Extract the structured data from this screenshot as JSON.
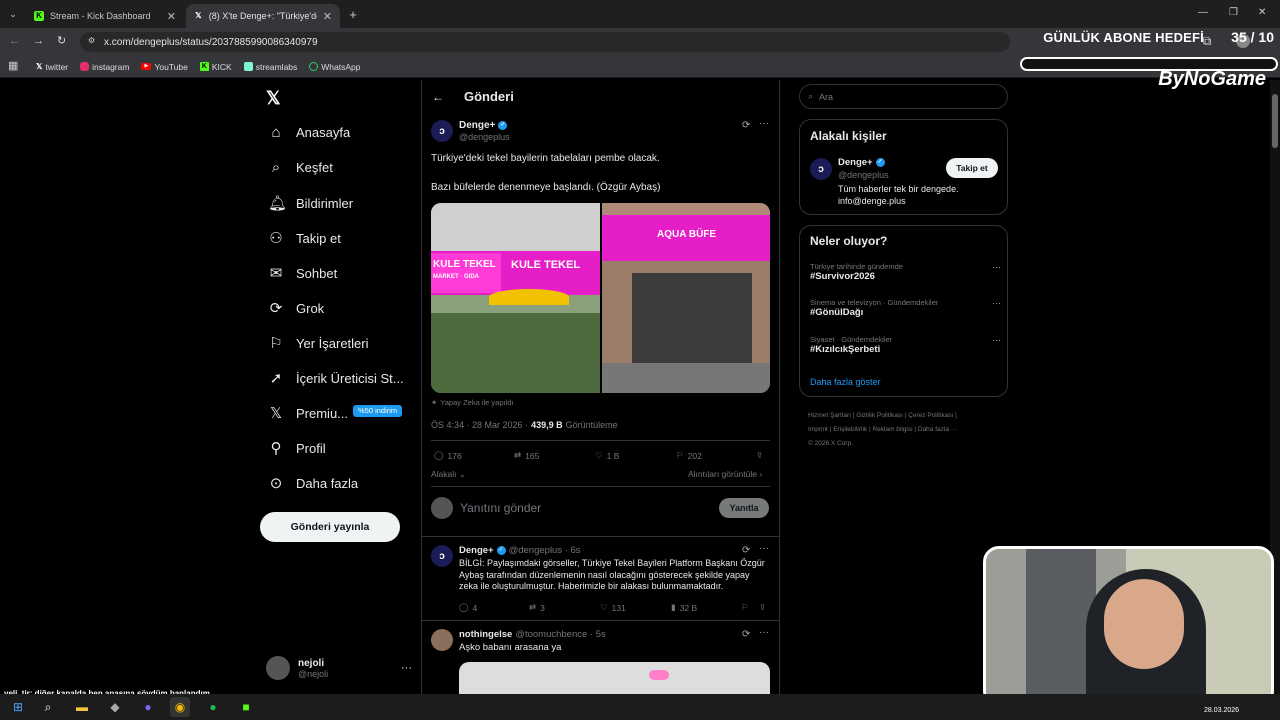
{
  "browser": {
    "tabs": [
      {
        "title": "Stream - Kick Dashboard",
        "icon": "kick-icon"
      },
      {
        "title": "(8) X'te Denge+: \"Türkiye'deki t",
        "icon": "x-icon"
      }
    ],
    "url": "x.com/dengeplus/status/2037885990086340979",
    "bookmarks": [
      {
        "label": "twitter",
        "icon": "x-icon"
      },
      {
        "label": "instagram",
        "icon": "instagram-icon"
      },
      {
        "label": "YouTube",
        "icon": "youtube-icon"
      },
      {
        "label": "KICK",
        "icon": "kick-icon"
      },
      {
        "label": "streamlabs",
        "icon": "streamlabs-icon"
      },
      {
        "label": "WhatsApp",
        "icon": "whatsapp-icon"
      }
    ]
  },
  "overlay": {
    "goal_label": "GÜNLÜK ABONE HEDEFİ",
    "goal_count": "35 / 10",
    "sponsor": "ByNoGame",
    "chat_line_user": "veli_tir",
    "chat_line_text": ": diğer kanalda ben anasına sövdüm banlandım",
    "date": "28.03.2026"
  },
  "nav": {
    "items": [
      {
        "label": "Anasayfa",
        "icon": "home-icon"
      },
      {
        "label": "Keşfet",
        "icon": "search-icon"
      },
      {
        "label": "Bildirimler",
        "icon": "bell-icon"
      },
      {
        "label": "Takip et",
        "icon": "person-add-icon"
      },
      {
        "label": "Sohbet",
        "icon": "mail-icon"
      },
      {
        "label": "Grok",
        "icon": "grok-icon"
      },
      {
        "label": "Yer İşaretleri",
        "icon": "bookmark-icon"
      },
      {
        "label": "İçerik Üreticisi St...",
        "icon": "rocket-icon"
      },
      {
        "label": "Premiu...",
        "icon": "x-icon"
      },
      {
        "label": "Profil",
        "icon": "person-icon"
      },
      {
        "label": "Daha fazla",
        "icon": "more-circle-icon"
      }
    ],
    "premium_badge": "%50 indirim",
    "post_button": "Gönderi yayınla",
    "account_name": "nejoli",
    "account_handle": "@nejoli"
  },
  "post": {
    "header": "Gönderi",
    "author": "Denge+",
    "handle": "@dengeplus",
    "text_line1": "Türkiye'deki tekel bayilerin tabelaları pembe olacak.",
    "text_line2": "Bazı büfelerde denenmeye başlandı. (Özgür Aybaş)",
    "image_left_sign": "KULE TEKEL",
    "image_left_sign2": "MARKET · GIDA",
    "image_right_sign": "AQUA BÜFE",
    "ai_label": "Yapay Zeka ile yapıldı",
    "time": "ÖS 4:34 · 28 Mar 2026 ·",
    "views_count": "439,9 B",
    "views_label": "Görüntüleme",
    "replies": "176",
    "reposts": "165",
    "likes": "1 B",
    "bookmarks": "202",
    "related_label": "Alakalı",
    "quotes_label": "Alıntıları görüntüle",
    "reply_placeholder": "Yanıtını gönder",
    "reply_button": "Yanıtla"
  },
  "replies": [
    {
      "author": "Denge+",
      "handle": "@dengeplus · 6s",
      "text": "BİLGİ: Paylaşımdaki görseller, Türkiye Tekel Bayileri Platform Başkanı Özgür Aybaş tarafından düzenlemenin nasıl olacağını gösterecek şekilde yapay zeka ile oluşturulmuştur. Haberimizle bir alakası bulunmamaktadır.",
      "replies": "4",
      "reposts": "3",
      "likes": "131",
      "views": "32 B"
    },
    {
      "author": "nothingelse",
      "handle": "@toomuchbence · 5s",
      "text": "Aşko babanı arasana ya"
    }
  ],
  "right": {
    "search_placeholder": "Ara",
    "related_title": "Alakalı kişiler",
    "related_name": "Denge+",
    "related_handle": "@dengeplus",
    "related_bio1": "Tüm haberler tek bir dengede.",
    "related_bio2": "info@denge.plus",
    "follow_button": "Takip et",
    "trends_title": "Neler oluyor?",
    "trends": [
      {
        "meta": "Türkiye tarihinde gündemde",
        "tag": "#Survivor2026"
      },
      {
        "meta": "Sinema ve televizyon · Gündemdekiler",
        "tag": "#GönülDağı"
      },
      {
        "meta": "Siyaset · Gündemdekiler",
        "tag": "#KızılcıkŞerbeti"
      }
    ],
    "show_more": "Daha fazla göster",
    "footer": [
      "Hizmet Şartları",
      "Gizlilik Politikası",
      "Çerez Politikası",
      "Imprint",
      "Erişilebilirlik",
      "Reklam bilgisi",
      "Daha fazla ···",
      "© 2026 X Corp."
    ]
  },
  "colors": {
    "accent": "#1d9bf0",
    "pink": "#e61ec8",
    "premium": "#1d9bf0"
  }
}
